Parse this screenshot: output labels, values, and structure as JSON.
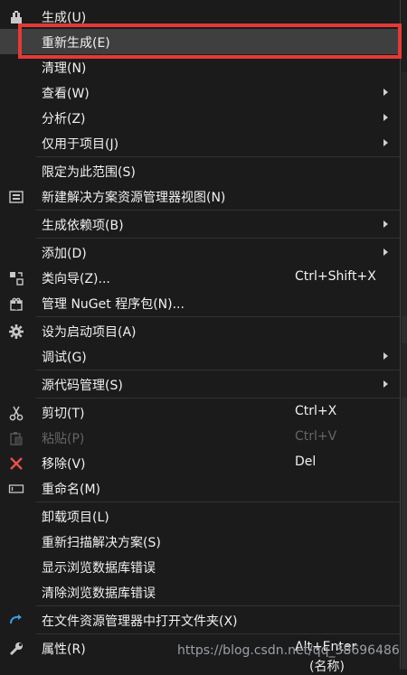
{
  "menu": {
    "items": [
      {
        "label": "生成(U)",
        "shortcut": "",
        "submenu": false,
        "icon": "build-icon",
        "disabled": false
      },
      {
        "label": "重新生成(E)",
        "shortcut": "",
        "submenu": false,
        "icon": "",
        "disabled": false,
        "highlighted": true
      },
      {
        "label": "清理(N)",
        "shortcut": "",
        "submenu": false,
        "icon": "",
        "disabled": false
      },
      {
        "label": "查看(W)",
        "shortcut": "",
        "submenu": true,
        "icon": "",
        "disabled": false
      },
      {
        "label": "分析(Z)",
        "shortcut": "",
        "submenu": true,
        "icon": "",
        "disabled": false
      },
      {
        "label": "仅用于项目(J)",
        "shortcut": "",
        "submenu": true,
        "icon": "",
        "disabled": false
      },
      {
        "label": "限定为此范围(S)",
        "shortcut": "",
        "submenu": false,
        "icon": "",
        "disabled": false
      },
      {
        "label": "新建解决方案资源管理器视图(N)",
        "shortcut": "",
        "submenu": false,
        "icon": "new-view-icon",
        "disabled": false
      },
      {
        "label": "生成依赖项(B)",
        "shortcut": "",
        "submenu": true,
        "icon": "",
        "disabled": false
      },
      {
        "label": "添加(D)",
        "shortcut": "",
        "submenu": true,
        "icon": "",
        "disabled": false
      },
      {
        "label": "类向导(Z)...",
        "shortcut": "Ctrl+Shift+X",
        "submenu": false,
        "icon": "class-wizard-icon",
        "disabled": false
      },
      {
        "label": "管理 NuGet 程序包(N)...",
        "shortcut": "",
        "submenu": false,
        "icon": "nuget-icon",
        "disabled": false
      },
      {
        "label": "设为启动项目(A)",
        "shortcut": "",
        "submenu": false,
        "icon": "gear-icon",
        "disabled": false
      },
      {
        "label": "调试(G)",
        "shortcut": "",
        "submenu": true,
        "icon": "",
        "disabled": false
      },
      {
        "label": "源代码管理(S)",
        "shortcut": "",
        "submenu": true,
        "icon": "",
        "disabled": false
      },
      {
        "label": "剪切(T)",
        "shortcut": "Ctrl+X",
        "submenu": false,
        "icon": "scissors-icon",
        "disabled": false
      },
      {
        "label": "粘贴(P)",
        "shortcut": "Ctrl+V",
        "submenu": false,
        "icon": "paste-icon",
        "disabled": true
      },
      {
        "label": "移除(V)",
        "shortcut": "Del",
        "submenu": false,
        "icon": "remove-icon",
        "disabled": false
      },
      {
        "label": "重命名(M)",
        "shortcut": "",
        "submenu": false,
        "icon": "rename-icon",
        "disabled": false
      },
      {
        "label": "卸载项目(L)",
        "shortcut": "",
        "submenu": false,
        "icon": "",
        "disabled": false
      },
      {
        "label": "重新扫描解决方案(S)",
        "shortcut": "",
        "submenu": false,
        "icon": "",
        "disabled": false
      },
      {
        "label": "显示浏览数据库错误",
        "shortcut": "",
        "submenu": false,
        "icon": "",
        "disabled": false
      },
      {
        "label": "清除浏览数据库错误",
        "shortcut": "",
        "submenu": false,
        "icon": "",
        "disabled": false
      },
      {
        "label": "在文件资源管理器中打开文件夹(X)",
        "shortcut": "",
        "submenu": false,
        "icon": "open-folder-icon",
        "disabled": false
      },
      {
        "label": "属性(R)",
        "shortcut": "Alt+Enter",
        "submenu": false,
        "icon": "wrench-icon",
        "disabled": false
      }
    ]
  },
  "watermark": "https://blog.csdn.net/qq_38696486",
  "bottom_text": "(名称)",
  "colors": {
    "background": "#1b1b1c",
    "hover": "#3f3f40",
    "highlight_border": "#e53935",
    "text": "#f1f1f1",
    "disabled_text": "#656565"
  }
}
